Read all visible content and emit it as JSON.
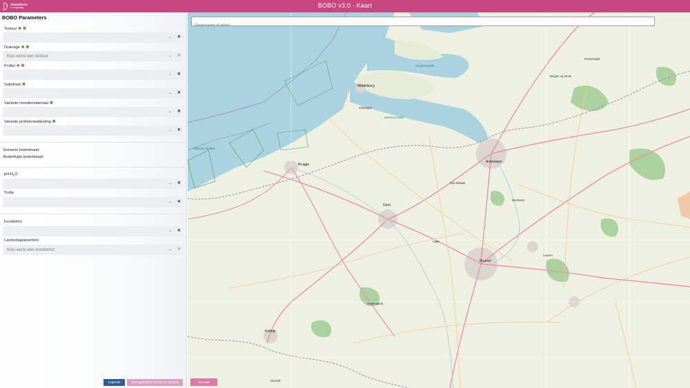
{
  "app": {
    "logo_name": "Vlaanderen",
    "logo_subtitle": "is omgeving",
    "title": "BOBO v3.0 - Kaart"
  },
  "sidebar": {
    "title": "BOBO Parameters",
    "fields": {
      "textuur": {
        "label": "Textuur",
        "placeholder": ""
      },
      "drainage": {
        "label": "Drainage",
        "placeholder": "Kies eerst een textuur"
      },
      "profiel": {
        "label": "Profiel",
        "placeholder": ""
      },
      "substraat": {
        "label": "Substraat",
        "placeholder": ""
      },
      "variante_moedermateriaal": {
        "label": "Variante moedermateriaal",
        "placeholder": ""
      },
      "variante_profielontwikkeling": {
        "label": "Variante profielontwikkeling",
        "placeholder": ""
      },
      "ph": {
        "label_main": "pH-H",
        "label_sub": "2",
        "label_end": "O",
        "placeholder": ""
      },
      "trofie": {
        "label": "Trofie",
        "placeholder": ""
      },
      "ecodistrict": {
        "label": "Ecodistrict",
        "placeholder": ""
      },
      "landschapselement": {
        "label": "Landschapselement",
        "placeholder": "Kies eerst een ecodistrict"
      }
    },
    "info": {
      "kenmerkende_bodemkaart": "Kenserie bodemkaart:",
      "bodemtype_bodemkaart": "Bodemtype bodemkaart:"
    },
    "buttons": {
      "legend": "Legende",
      "show": "Toon geschikte bomen en struiken"
    }
  },
  "map": {
    "search_placeholder": "Plaatsnaam of adres",
    "go_button": "Ga naar",
    "labels": [
      {
        "text": "Middelburg",
        "kind": "city"
      },
      {
        "text": "Vlissingen",
        "kind": "city"
      },
      {
        "text": "Brugge",
        "kind": "city"
      },
      {
        "text": "Gent",
        "kind": "city"
      },
      {
        "text": "Antwerpen",
        "kind": "city"
      },
      {
        "text": "Brussel",
        "kind": "city"
      },
      {
        "text": "Kortrijk",
        "kind": "city"
      },
      {
        "text": "Aalst",
        "kind": "city"
      },
      {
        "text": "Mechelen",
        "kind": "city"
      },
      {
        "text": "Leuven",
        "kind": "city"
      },
      {
        "text": "Bergen op Zoom",
        "kind": "city"
      },
      {
        "text": "Roosendaal",
        "kind": "city"
      },
      {
        "text": "Sint-Niklaas",
        "kind": "city"
      },
      {
        "text": "Oudenaarde",
        "kind": "city"
      },
      {
        "text": "Doornik",
        "kind": "city"
      },
      {
        "text": "Westerschelde",
        "kind": "water"
      },
      {
        "text": "Vlaamse Banken",
        "kind": "water"
      },
      {
        "text": "Oosterschelde",
        "kind": "water"
      }
    ]
  }
}
